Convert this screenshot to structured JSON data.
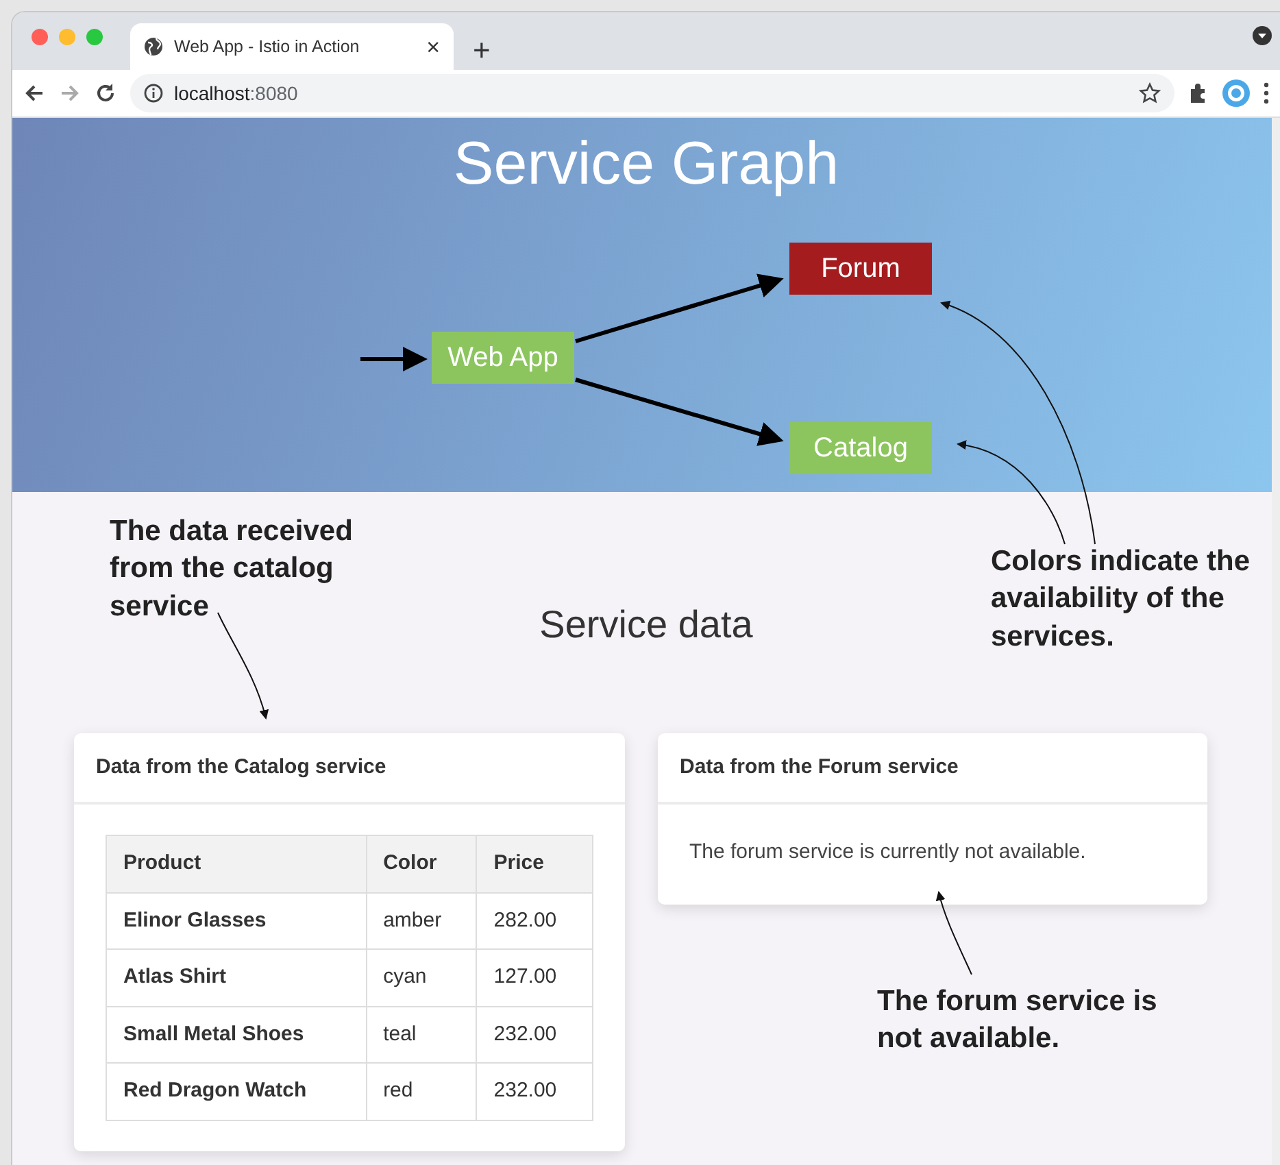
{
  "browser": {
    "tab_title": "Web App - Istio in Action",
    "tab_close": "×",
    "new_tab": "+",
    "url_host": "localhost",
    "url_port": ":8080"
  },
  "header": {
    "title": "Service Graph",
    "nodes": [
      {
        "label": "Web App",
        "available": true
      },
      {
        "label": "Forum",
        "available": false
      },
      {
        "label": "Catalog",
        "available": true
      }
    ]
  },
  "section_title": "Service data",
  "catalog_card": {
    "title": "Data from the Catalog service",
    "columns": [
      "Product",
      "Color",
      "Price"
    ],
    "rows": [
      [
        "Elinor Glasses",
        "amber",
        "282.00"
      ],
      [
        "Atlas Shirt",
        "cyan",
        "127.00"
      ],
      [
        "Small Metal Shoes",
        "teal",
        "232.00"
      ],
      [
        "Red Dragon Watch",
        "red",
        "232.00"
      ]
    ]
  },
  "forum_card": {
    "title": "Data from the Forum service",
    "message": "The forum service is currently not available."
  },
  "annotations": [
    {
      "text": "The data received\nfrom the catalog\nservice"
    },
    {
      "text": "Colors indicate the\navailability of the\nservices."
    },
    {
      "text": "The forum service is\nnot available."
    }
  ]
}
